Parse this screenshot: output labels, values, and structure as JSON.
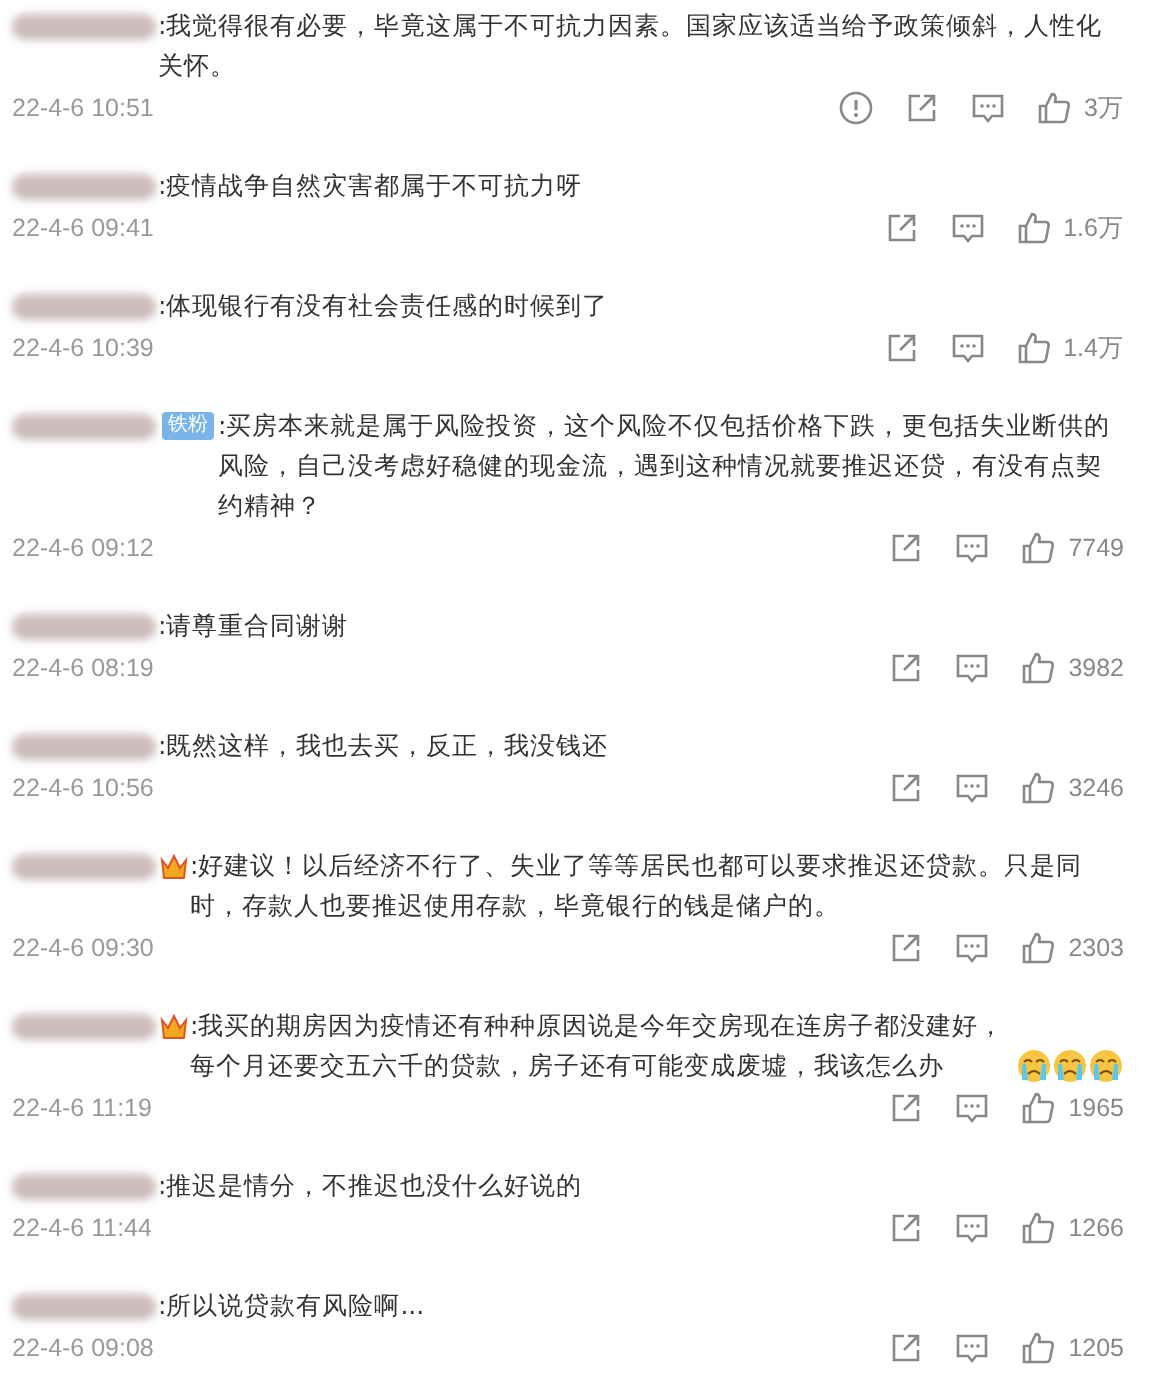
{
  "comments": [
    {
      "text": ":我觉得很有必要，毕竟这属于不可抗力因素。国家应该适当给予政策倾斜，人性化关怀。",
      "time": "22-4-6 10:51",
      "report": true,
      "likes": "3万"
    },
    {
      "text": ":疫情战争自然灾害都属于不可抗力呀",
      "time": "22-4-6 09:41",
      "likes": "1.6万"
    },
    {
      "text": ":体现银行有没有社会责任感的时候到了",
      "time": "22-4-6 10:39",
      "likes": "1.4万"
    },
    {
      "badge": "铁粉",
      "text": ":买房本来就是属于风险投资，这个风险不仅包括价格下跌，更包括失业断供的风险，自己没考虑好稳健的现金流，遇到这种情况就要推迟还贷，有没有点契约精神？",
      "time": "22-4-6 09:12",
      "likes": "7749"
    },
    {
      "text": ":请尊重合同谢谢",
      "time": "22-4-6 08:19",
      "likes": "3982"
    },
    {
      "text": ":既然这样，我也去买，反正，我没钱还",
      "time": "22-4-6 10:56",
      "likes": "3246"
    },
    {
      "crown": true,
      "text": ":好建议！以后经济不行了、失业了等等居民也都可以要求推迟还贷款。只是同时，存款人也要推迟使用存款，毕竟银行的钱是储户的。",
      "time": "22-4-6 09:30",
      "likes": "2303"
    },
    {
      "crown": true,
      "text": ":我买的期房因为疫情还有种种原因说是今年交房现在连房子都没建好，每个月还要交五六千的贷款，房子还有可能变成废墟，我该怎么办",
      "emojis": [
        {
          "kind": "crying"
        },
        {
          "kind": "crying"
        },
        {
          "kind": "crying"
        }
      ],
      "time": "22-4-6 11:19",
      "likes": "1965"
    },
    {
      "text": ":推迟是情分，不推迟也没什么好说的",
      "time": "22-4-6 11:44",
      "likes": "1266"
    },
    {
      "text": ":所以说贷款有风险啊...",
      "time": "22-4-6 09:08",
      "likes": "1205"
    }
  ]
}
